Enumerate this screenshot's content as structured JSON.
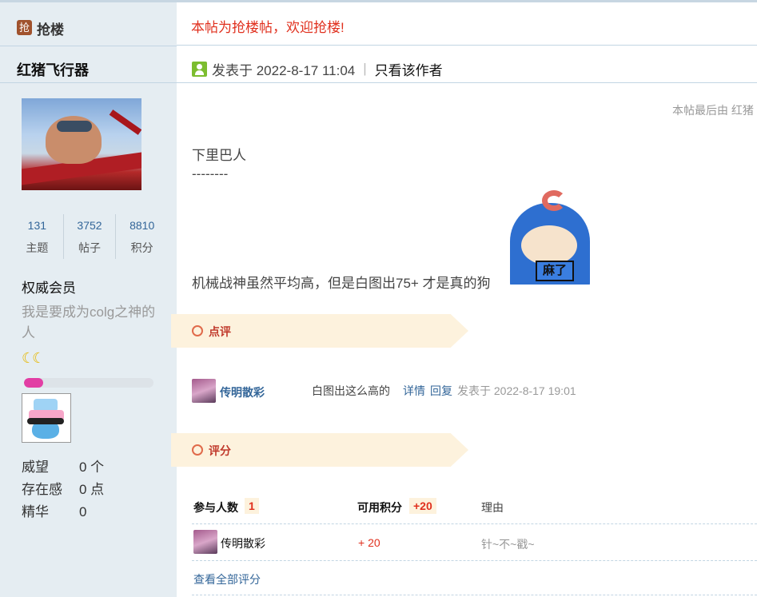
{
  "sidebar": {
    "qianglou_badge": "抢",
    "qianglou_title": "抢楼",
    "author_name": "红猪飞行器",
    "stats": [
      {
        "value": "131",
        "label": "主题"
      },
      {
        "value": "3752",
        "label": "帖子"
      },
      {
        "value": "8810",
        "label": "积分"
      }
    ],
    "rank": "权威会员",
    "signature": "我是要成为colg之神的人",
    "moons": "☾☾",
    "level_progress": 0.15,
    "info": [
      {
        "key": "威望",
        "value": "0 个"
      },
      {
        "key": "存在感",
        "value": "0 点"
      },
      {
        "key": "精华",
        "value": "0"
      }
    ]
  },
  "notice": "本帖为抢楼帖，欢迎抢楼!",
  "post": {
    "posted_label": "发表于 2022-8-17 11:04",
    "separator": "|",
    "only_author": "只看该作者",
    "edited_note": "本帖最后由 红猪",
    "lines": [
      "下里巴人",
      "--------",
      "机械战神虽然平均高，但是白图出75+ 才是真的狗"
    ],
    "emoji_text": "麻了"
  },
  "comments_section": {
    "title": "点评",
    "items": [
      {
        "user": "传明散彩",
        "text": "白图出这么高的",
        "detail": "详情",
        "reply": "回复",
        "time": "发表于 2022-8-17 19:01"
      }
    ]
  },
  "rating_section": {
    "title": "评分",
    "participants_label": "参与人数",
    "participants": "1",
    "points_label": "可用积分",
    "points": "+20",
    "reason_label": "理由",
    "rows": [
      {
        "user": "传明散彩",
        "score": "+ 20",
        "reason": "针~不~戳~"
      }
    ],
    "view_all": "查看全部评分"
  },
  "colors": {
    "sidebar_bg": "#e5edf2",
    "accent_red": "#e0301e",
    "link_blue": "#336699",
    "ribbon_bg": "#fdf2dd"
  }
}
